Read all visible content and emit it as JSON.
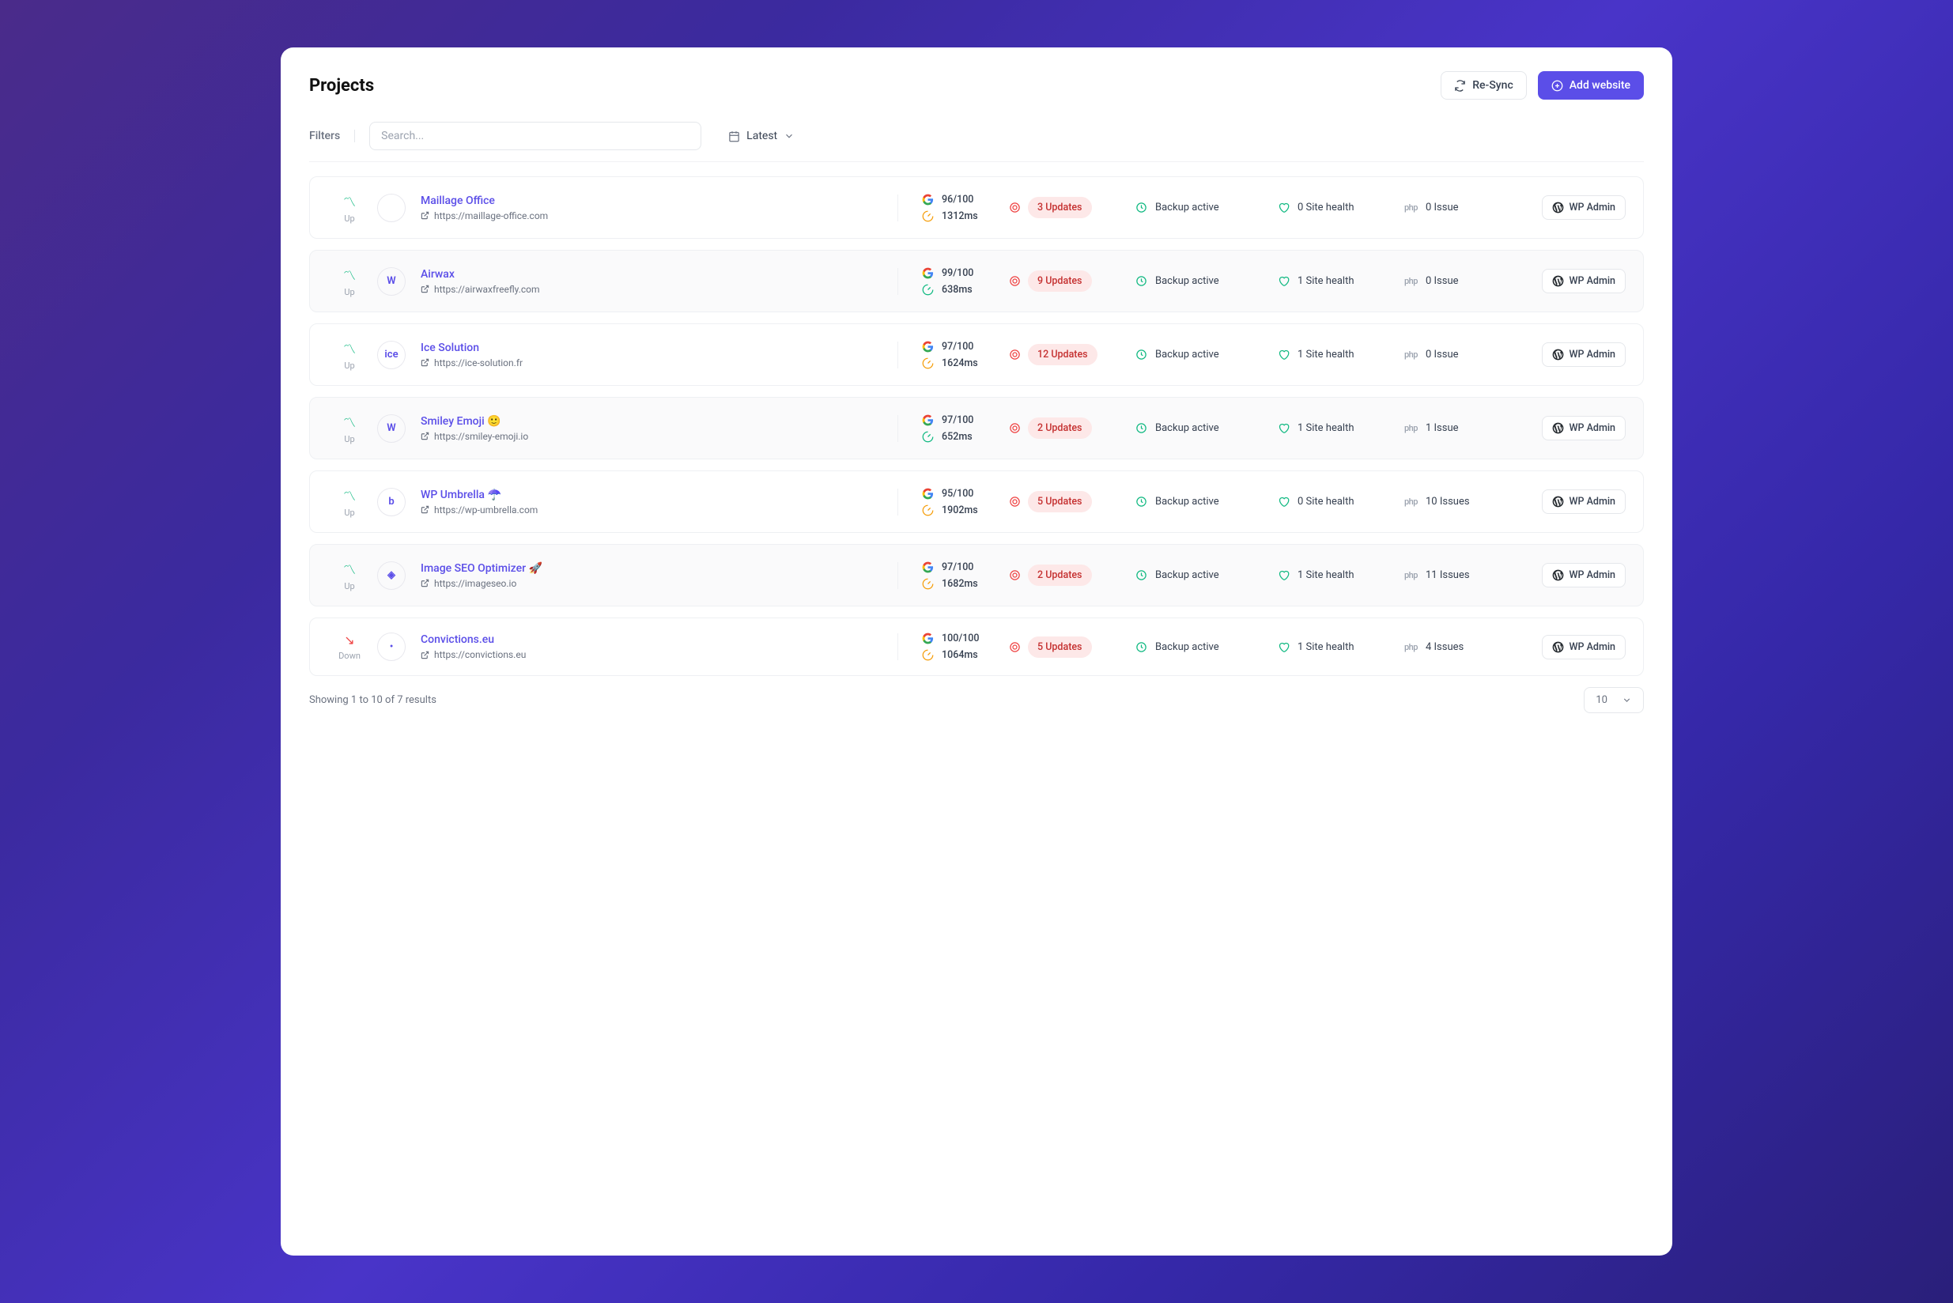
{
  "header": {
    "title": "Projects",
    "resync": "Re-Sync",
    "add": "Add website"
  },
  "toolbar": {
    "filters": "Filters",
    "search_ph": "Search...",
    "sort": "Latest"
  },
  "rows": [
    {
      "status": "Up",
      "up": true,
      "logo": "",
      "name": "Maillage Office",
      "url": "https://maillage-office.com",
      "score": "96/100",
      "speed": "1312ms",
      "updates": "3 Updates",
      "backup": "Backup active",
      "health": "0 Site health",
      "issues": "0 Issue",
      "admin": "WP Admin"
    },
    {
      "status": "Up",
      "up": true,
      "logo": "W",
      "name": "Airwax",
      "url": "https://airwaxfreefly.com",
      "score": "99/100",
      "speed": "638ms",
      "updates": "9 Updates",
      "backup": "Backup active",
      "health": "1 Site health",
      "issues": "0 Issue",
      "admin": "WP Admin"
    },
    {
      "status": "Up",
      "up": true,
      "logo": "ice",
      "name": "Ice Solution",
      "url": "https://ice-solution.fr",
      "score": "97/100",
      "speed": "1624ms",
      "updates": "12 Updates",
      "backup": "Backup active",
      "health": "1 Site health",
      "issues": "0 Issue",
      "admin": "WP Admin"
    },
    {
      "status": "Up",
      "up": true,
      "logo": "W",
      "name": "Smiley Emoji 🙂",
      "url": "https://smiley-emoji.io",
      "score": "97/100",
      "speed": "652ms",
      "updates": "2 Updates",
      "backup": "Backup active",
      "health": "1 Site health",
      "issues": "1 Issue",
      "admin": "WP Admin"
    },
    {
      "status": "Up",
      "up": true,
      "logo": "b",
      "name": "WP Umbrella ☂️",
      "url": "https://wp-umbrella.com",
      "score": "95/100",
      "speed": "1902ms",
      "updates": "5 Updates",
      "backup": "Backup active",
      "health": "0 Site health",
      "issues": "10 Issues",
      "admin": "WP Admin"
    },
    {
      "status": "Up",
      "up": true,
      "logo": "◈",
      "name": "Image SEO Optimizer 🚀",
      "url": "https://imageseo.io",
      "score": "97/100",
      "speed": "1682ms",
      "updates": "2 Updates",
      "backup": "Backup active",
      "health": "1 Site health",
      "issues": "11 Issues",
      "admin": "WP Admin"
    },
    {
      "status": "Down",
      "up": false,
      "logo": "•",
      "name": "Convictions.eu",
      "url": "https://convictions.eu",
      "score": "100/100",
      "speed": "1064ms",
      "updates": "5 Updates",
      "backup": "Backup active",
      "health": "1 Site health",
      "issues": "4 Issues",
      "admin": "WP Admin"
    }
  ],
  "footer": {
    "text": "Showing 1 to 10 of 7 results",
    "page_size": "10"
  }
}
